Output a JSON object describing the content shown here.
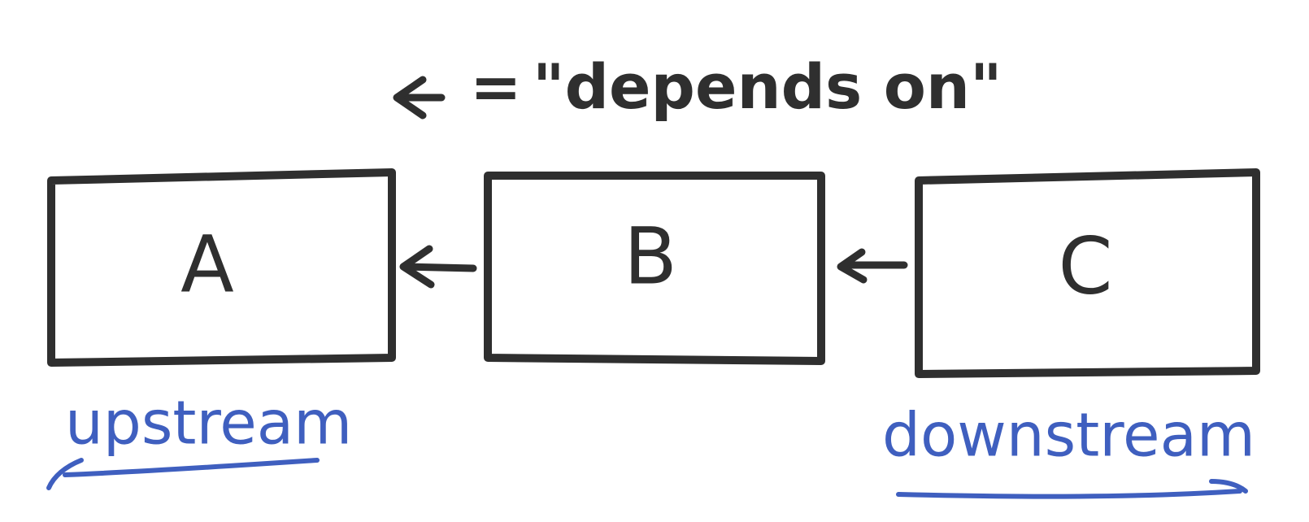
{
  "legend": {
    "symbol": "←",
    "equals": "=",
    "meaning": "\"depends on\""
  },
  "nodes": [
    {
      "id": "A",
      "label": "A"
    },
    {
      "id": "B",
      "label": "B"
    },
    {
      "id": "C",
      "label": "C"
    }
  ],
  "edges": [
    {
      "from": "B",
      "to": "A",
      "relation": "depends on"
    },
    {
      "from": "C",
      "to": "B",
      "relation": "depends on"
    }
  ],
  "directions": {
    "upstream": "upstream",
    "downstream": "downstream"
  },
  "colors": {
    "ink": "#2f2f2f",
    "annotation": "#3f5fbf"
  }
}
